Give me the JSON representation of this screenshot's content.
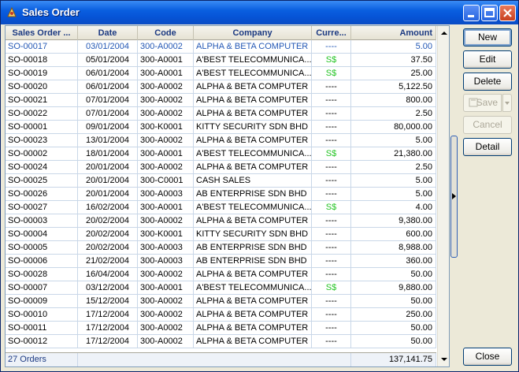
{
  "window": {
    "title": "Sales Order",
    "icon": "app-icon"
  },
  "grid": {
    "columns": [
      "Sales Order ...",
      "Date",
      "Code",
      "Company",
      "Curre...",
      "Amount"
    ],
    "rows": [
      {
        "so": "SO-00017",
        "date": "03/01/2004",
        "code": "300-A0002",
        "company": "ALPHA & BETA COMPUTER",
        "currency": "----",
        "amount": "5.00",
        "selected": true
      },
      {
        "so": "SO-00018",
        "date": "05/01/2004",
        "code": "300-A0001",
        "company": "A'BEST TELECOMMUNICA...",
        "currency": "S$",
        "amount": "37.50"
      },
      {
        "so": "SO-00019",
        "date": "06/01/2004",
        "code": "300-A0001",
        "company": "A'BEST TELECOMMUNICA...",
        "currency": "S$",
        "amount": "25.00"
      },
      {
        "so": "SO-00020",
        "date": "06/01/2004",
        "code": "300-A0002",
        "company": "ALPHA & BETA COMPUTER",
        "currency": "----",
        "amount": "5,122.50"
      },
      {
        "so": "SO-00021",
        "date": "07/01/2004",
        "code": "300-A0002",
        "company": "ALPHA & BETA COMPUTER",
        "currency": "----",
        "amount": "800.00"
      },
      {
        "so": "SO-00022",
        "date": "07/01/2004",
        "code": "300-A0002",
        "company": "ALPHA & BETA COMPUTER",
        "currency": "----",
        "amount": "2.50"
      },
      {
        "so": "SO-00001",
        "date": "09/01/2004",
        "code": "300-K0001",
        "company": "KITTY SECURITY SDN BHD",
        "currency": "----",
        "amount": "80,000.00"
      },
      {
        "so": "SO-00023",
        "date": "13/01/2004",
        "code": "300-A0002",
        "company": "ALPHA & BETA COMPUTER",
        "currency": "----",
        "amount": "5.00"
      },
      {
        "so": "SO-00002",
        "date": "18/01/2004",
        "code": "300-A0001",
        "company": "A'BEST TELECOMMUNICA...",
        "currency": "S$",
        "amount": "21,380.00"
      },
      {
        "so": "SO-00024",
        "date": "20/01/2004",
        "code": "300-A0002",
        "company": "ALPHA & BETA COMPUTER",
        "currency": "----",
        "amount": "2.50"
      },
      {
        "so": "SO-00025",
        "date": "20/01/2004",
        "code": "300-C0001",
        "company": "CASH SALES",
        "currency": "----",
        "amount": "5.00"
      },
      {
        "so": "SO-00026",
        "date": "20/01/2004",
        "code": "300-A0003",
        "company": "AB ENTERPRISE SDN BHD",
        "currency": "----",
        "amount": "5.00"
      },
      {
        "so": "SO-00027",
        "date": "16/02/2004",
        "code": "300-A0001",
        "company": "A'BEST TELECOMMUNICA...",
        "currency": "S$",
        "amount": "4.00"
      },
      {
        "so": "SO-00003",
        "date": "20/02/2004",
        "code": "300-A0002",
        "company": "ALPHA & BETA COMPUTER",
        "currency": "----",
        "amount": "9,380.00"
      },
      {
        "so": "SO-00004",
        "date": "20/02/2004",
        "code": "300-K0001",
        "company": "KITTY SECURITY SDN BHD",
        "currency": "----",
        "amount": "600.00"
      },
      {
        "so": "SO-00005",
        "date": "20/02/2004",
        "code": "300-A0003",
        "company": "AB ENTERPRISE SDN BHD",
        "currency": "----",
        "amount": "8,988.00"
      },
      {
        "so": "SO-00006",
        "date": "21/02/2004",
        "code": "300-A0003",
        "company": "AB ENTERPRISE SDN BHD",
        "currency": "----",
        "amount": "360.00"
      },
      {
        "so": "SO-00028",
        "date": "16/04/2004",
        "code": "300-A0002",
        "company": "ALPHA & BETA COMPUTER",
        "currency": "----",
        "amount": "50.00"
      },
      {
        "so": "SO-00007",
        "date": "03/12/2004",
        "code": "300-A0001",
        "company": "A'BEST TELECOMMUNICA...",
        "currency": "S$",
        "amount": "9,880.00"
      },
      {
        "so": "SO-00009",
        "date": "15/12/2004",
        "code": "300-A0002",
        "company": "ALPHA & BETA COMPUTER",
        "currency": "----",
        "amount": "50.00"
      },
      {
        "so": "SO-00010",
        "date": "17/12/2004",
        "code": "300-A0002",
        "company": "ALPHA & BETA COMPUTER",
        "currency": "----",
        "amount": "250.00"
      },
      {
        "so": "SO-00011",
        "date": "17/12/2004",
        "code": "300-A0002",
        "company": "ALPHA & BETA COMPUTER",
        "currency": "----",
        "amount": "50.00"
      },
      {
        "so": "SO-00012",
        "date": "17/12/2004",
        "code": "300-A0002",
        "company": "ALPHA & BETA COMPUTER",
        "currency": "----",
        "amount": "50.00"
      }
    ],
    "footer": {
      "count": "27 Orders",
      "total": "137,141.75"
    }
  },
  "buttons": {
    "new": "New",
    "edit": "Edit",
    "delete": "Delete",
    "save": "Save",
    "cancel": "Cancel",
    "detail": "Detail",
    "close": "Close"
  },
  "colors": {
    "accent": "#0a5fe0",
    "selected_text": "#2458b5",
    "currency_sgd": "#24c424"
  }
}
